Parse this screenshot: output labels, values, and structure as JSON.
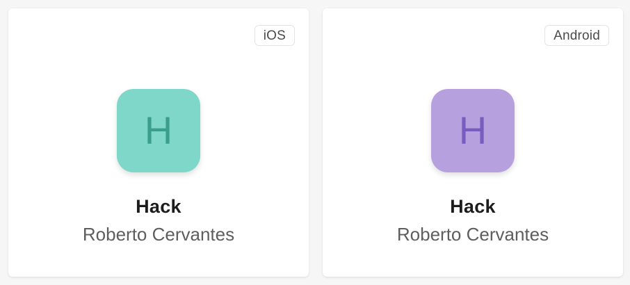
{
  "apps": [
    {
      "platform": "iOS",
      "initial": "H",
      "name": "Hack",
      "owner": "Roberto Cervantes",
      "icon_bg": "#7ed7c9",
      "icon_fg": "#3a9e8b"
    },
    {
      "platform": "Android",
      "initial": "H",
      "name": "Hack",
      "owner": "Roberto Cervantes",
      "icon_bg": "#b6a1de",
      "icon_fg": "#7a5cc0"
    }
  ]
}
